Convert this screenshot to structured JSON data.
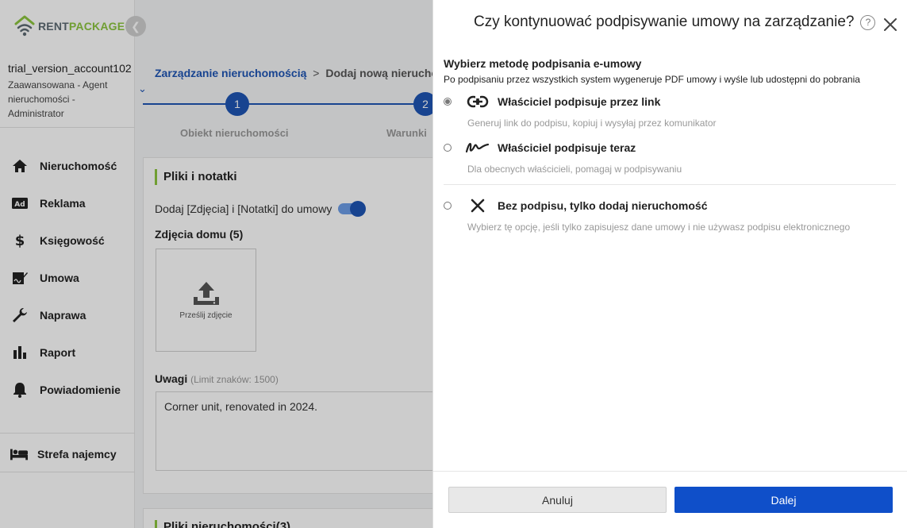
{
  "sidebar": {
    "logo_rent": "RENT",
    "logo_package": "PACKAGE",
    "account_name": "trial_version_account102",
    "account_role": "Zaawansowana - Agent nieruchomości - Administrator",
    "items": [
      {
        "label": "Nieruchomość",
        "icon": "home-icon"
      },
      {
        "label": "Reklama",
        "icon": "ad-icon"
      },
      {
        "label": "Księgowość",
        "icon": "dollar-icon"
      },
      {
        "label": "Umowa",
        "icon": "contract-icon"
      },
      {
        "label": "Naprawa",
        "icon": "wrench-icon"
      },
      {
        "label": "Raport",
        "icon": "chart-icon"
      },
      {
        "label": "Powiadomienie",
        "icon": "bell-icon"
      }
    ],
    "tenant_label": "Strefa najemcy"
  },
  "main": {
    "breadcrumb_link": "Zarządzanie nieruchomością",
    "breadcrumb_sep": ">",
    "breadcrumb_current": "Dodaj nową nieruchomość",
    "steps": [
      {
        "number": "1",
        "label": "Obiekt nieruchomości"
      },
      {
        "number": "2",
        "label": "Warunki"
      }
    ],
    "card_title": "Pliki i notatki",
    "attach_label": "Dodaj [Zdjęcia] i [Notatki] do umowy",
    "photos_title": "Zdjęcia domu (5)",
    "upload_label": "Prześlij zdjęcie",
    "notes_title": "Uwagi",
    "notes_limit": "(Limit znaków: 1500)",
    "notes_value": "Corner unit, renovated in 2024.",
    "card2_title": "Pliki nieruchomości(3)"
  },
  "drawer": {
    "title": "Czy kontynuować podpisywanie umowy na zarządzanie?",
    "help": "?",
    "method_title": "Wybierz metodę podpisania e-umowy",
    "method_desc": "Po podpisaniu przez wszystkich system wygeneruje PDF umowy i wyśle lub udostępni do pobrania",
    "options": [
      {
        "label": "Właściciel podpisuje przez link",
        "sub": "Generuj link do podpisu, kopiuj i wysyłaj przez komunikator",
        "icon": "link-icon",
        "selected": true
      },
      {
        "label": "Właściciel podpisuje teraz",
        "sub": "Dla obecnych właścicieli, pomagaj w podpisywaniu",
        "icon": "signature-icon",
        "selected": false
      },
      {
        "label": "Bez podpisu, tylko dodaj nieruchomość",
        "sub": "Wybierz tę opcję, jeśli tylko zapisujesz dane umowy i nie używasz podpisu elektronicznego",
        "icon": "x-icon",
        "selected": false
      }
    ],
    "cancel_label": "Anuluj",
    "next_label": "Dalej"
  },
  "colors": {
    "primary": "#1f55b5",
    "button_primary": "#0f4fc9",
    "accent_green": "#8cc63f"
  }
}
